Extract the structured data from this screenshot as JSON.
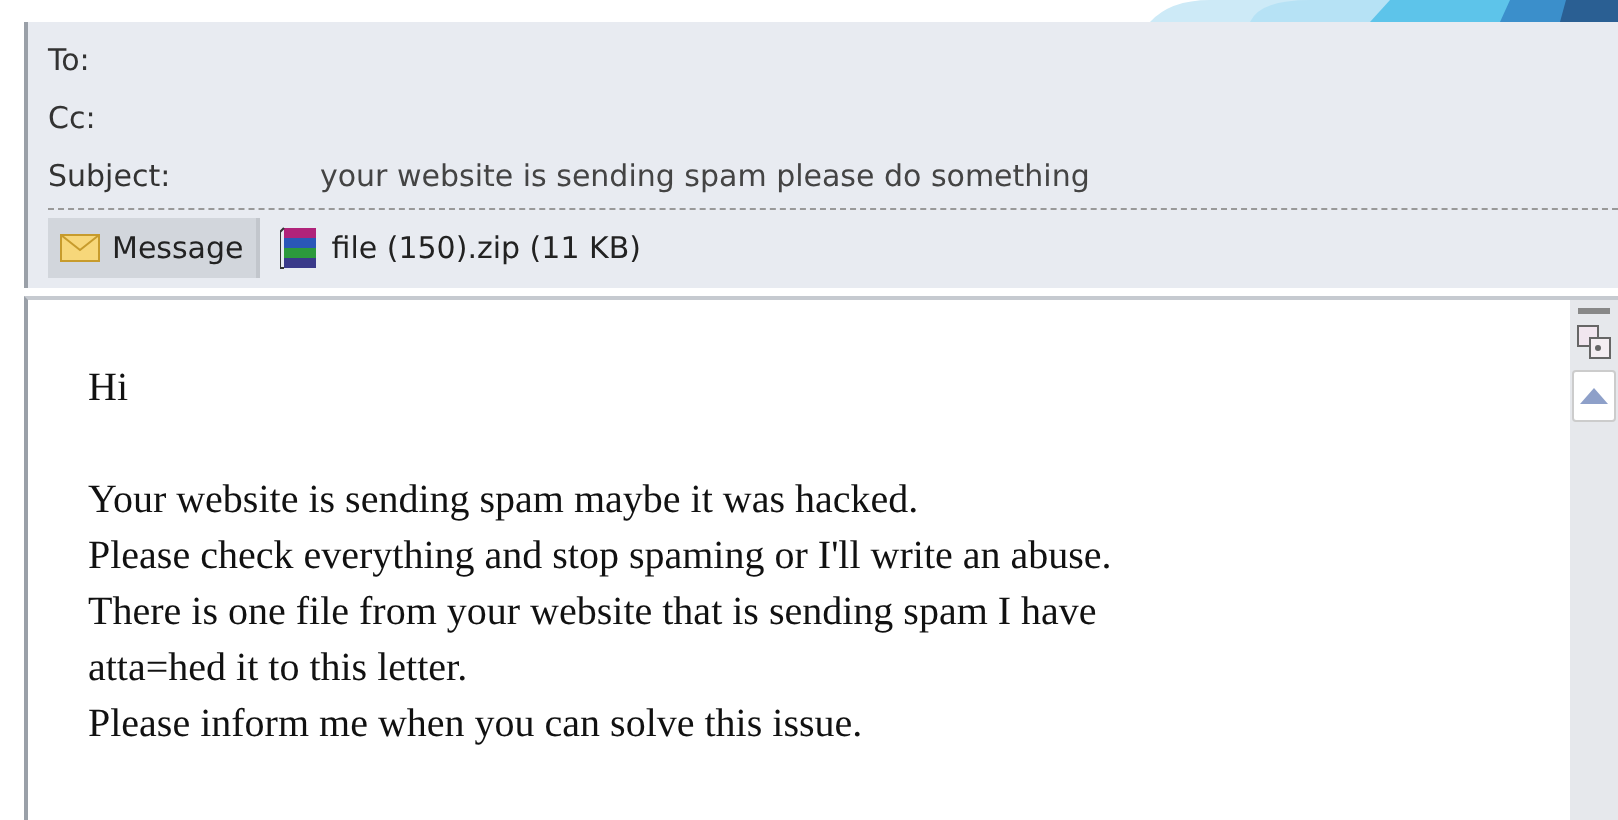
{
  "header": {
    "fields": [
      {
        "label": "To:"
      },
      {
        "label": "Cc:"
      },
      {
        "label": "Subject:",
        "value": "your website is sending spam please do something"
      }
    ]
  },
  "tabs": [
    {
      "label": "Message",
      "kind": "message",
      "selected": true
    },
    {
      "label": "file (150).zip (11 KB)",
      "kind": "archive",
      "selected": false
    }
  ],
  "body": {
    "paragraphs": [
      [
        "Hi"
      ],
      [
        "Your website is sending spam maybe it was hacked.",
        "Please check everything and stop spaming or I'll write an abuse.",
        "There is one file from your website that is sending spam I have",
        "atta=hed it to this letter.",
        "Please inform me when you can solve this issue."
      ]
    ]
  }
}
